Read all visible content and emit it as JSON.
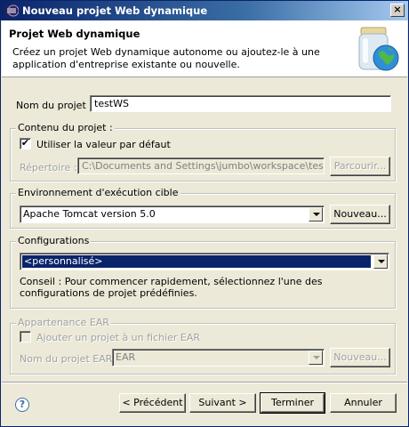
{
  "window": {
    "title": "Nouveau projet Web dynamique",
    "close_glyph": "×"
  },
  "header": {
    "title": "Projet Web dynamique",
    "description": "Créez un projet Web dynamique autonome ou ajoutez-le à une application d'entreprise existante ou nouvelle."
  },
  "project_name": {
    "label": "Nom du projet :",
    "value": "testWS"
  },
  "contents": {
    "group_title": "Contenu du projet :",
    "use_default_label": "Utiliser la valeur par défaut",
    "use_default_checked": true,
    "directory_label": "Répertoire :",
    "directory_value": "C:\\Documents and Settings\\jumbo\\workspace\\testWS",
    "browse_label": "Parcourir..."
  },
  "runtime": {
    "group_title": "Environnement d'exécution cible",
    "selected": "Apache Tomcat version 5.0",
    "new_label": "Nouveau..."
  },
  "configurations": {
    "group_title": "Configurations",
    "selected": "<personnalisé>",
    "hint": "Conseil : Pour commencer rapidement, sélectionnez l'une des configurations de projet prédéfinies."
  },
  "ear": {
    "group_title": "Appartenance EAR",
    "add_label": "Ajouter un projet à un fichier EAR",
    "add_checked": false,
    "name_label": "Nom du projet EAR :",
    "name_value": "EAR",
    "new_label": "Nouveau..."
  },
  "footer": {
    "help_glyph": "?",
    "back_label": "< Précédent",
    "next_label": "Suivant >",
    "finish_label": "Terminer",
    "cancel_label": "Annuler"
  }
}
